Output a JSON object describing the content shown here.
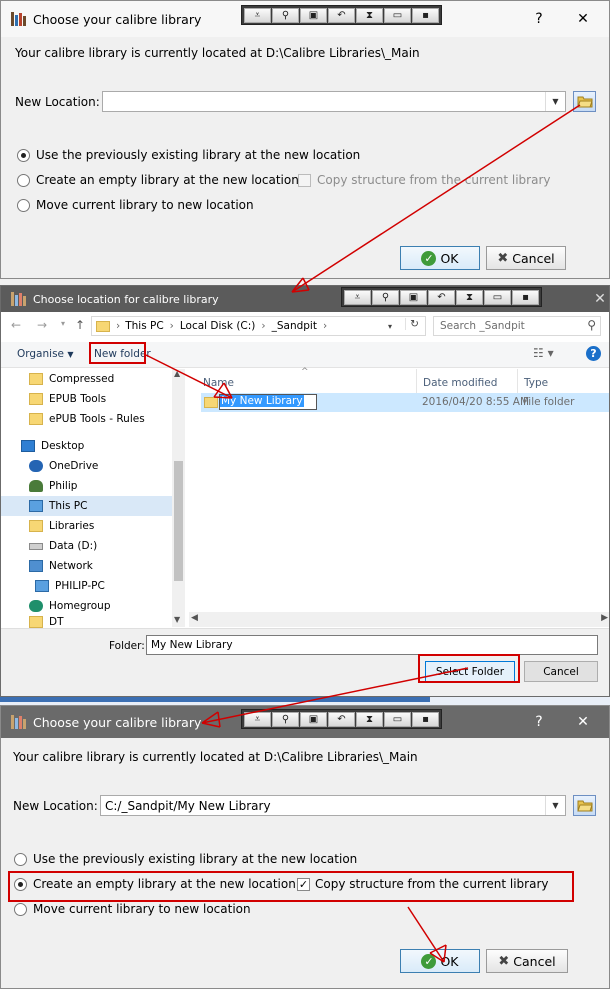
{
  "colors": {
    "accent": "#0078d7",
    "annotation": "#d10000",
    "titlebar_dark": "#5b5b5b"
  },
  "dialog1": {
    "title": "Choose your calibre library",
    "help_glyph": "?",
    "close_glyph": "✕",
    "current_location_text": "Your calibre library is currently located at D:\\Calibre Libraries\\_Main",
    "new_location_label": "New Location:",
    "new_location_value": "",
    "options": [
      {
        "label": "Use the previously existing library at the new location",
        "checked": true
      },
      {
        "label": "Create an empty library at the new location",
        "checked": false
      },
      {
        "label": "Move current library to new location",
        "checked": false
      }
    ],
    "copy_structure_label": "Copy structure from the current library",
    "copy_structure_checked": false,
    "ok_label": "OK",
    "cancel_label": "Cancel"
  },
  "dialog2": {
    "title": "Choose location for calibre library",
    "close_glyph": "✕",
    "breadcrumb": [
      "This PC",
      "Local Disk (C:)",
      "_Sandpit"
    ],
    "search_placeholder": "Search _Sandpit",
    "organise_label": "Organise",
    "new_folder_label": "New folder",
    "help_glyph": "?",
    "nav_items": [
      {
        "label": "Compressed",
        "icon": "folder-icon"
      },
      {
        "label": "EPUB Tools",
        "icon": "folder-icon"
      },
      {
        "label": "ePUB Tools - Rules",
        "icon": "folder-icon"
      },
      {
        "label": "Desktop",
        "icon": "desktop-icon"
      },
      {
        "label": "OneDrive",
        "icon": "cloud-icon"
      },
      {
        "label": "Philip",
        "icon": "user-icon"
      },
      {
        "label": "This PC",
        "icon": "computer-icon"
      },
      {
        "label": "Libraries",
        "icon": "libraries-icon"
      },
      {
        "label": "Data (D:)",
        "icon": "drive-icon"
      },
      {
        "label": "Network",
        "icon": "network-icon"
      },
      {
        "label": "PHILIP-PC",
        "icon": "computer-icon"
      },
      {
        "label": "Homegroup",
        "icon": "homegroup-icon"
      },
      {
        "label": "DT",
        "icon": "folder-icon"
      }
    ],
    "columns": [
      "Name",
      "Date modified",
      "Type"
    ],
    "rows": [
      {
        "name": "My New Library",
        "date": "2016/04/20 8:55 AM",
        "type": "File folder"
      }
    ],
    "folder_label": "Folder:",
    "folder_value": "My New Library",
    "select_folder_label": "Select Folder",
    "cancel_label": "Cancel"
  },
  "dialog3": {
    "title": "Choose your calibre library",
    "help_glyph": "?",
    "close_glyph": "✕",
    "current_location_text": "Your calibre library is currently located at D:\\Calibre Libraries\\_Main",
    "new_location_label": "New Location:",
    "new_location_value": "C:/_Sandpit/My New Library",
    "options": [
      {
        "label": "Use the previously existing library at the new location",
        "checked": false
      },
      {
        "label": "Create an empty library at the new location",
        "checked": true
      },
      {
        "label": "Move current library to new location",
        "checked": false
      }
    ],
    "copy_structure_label": "Copy structure from the current library",
    "copy_structure_checked": true,
    "ok_label": "OK",
    "cancel_label": "Cancel"
  }
}
